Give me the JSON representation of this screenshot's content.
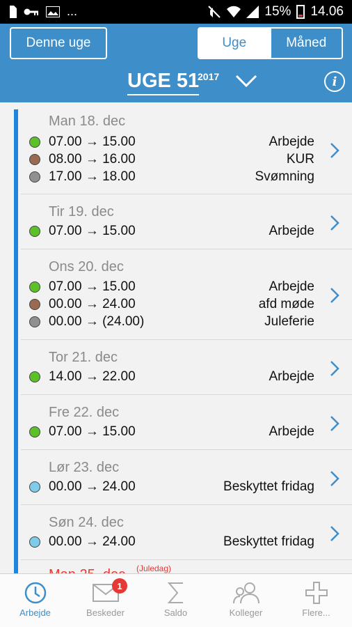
{
  "statusbar": {
    "left_icons": [
      "sim-icon",
      "key-icon",
      "image-icon"
    ],
    "ellipsis": "...",
    "battery": "15%",
    "time": "14.06"
  },
  "header": {
    "this_week_label": "Denne uge",
    "segment": [
      {
        "label": "Uge",
        "active": true
      },
      {
        "label": "Måned",
        "active": false
      }
    ],
    "week_title": "UGE 51",
    "year": "2017",
    "info_label": "i"
  },
  "days": [
    {
      "title": "Man 18. dec",
      "events": [
        {
          "time": "07.00 → 15.00",
          "name": "Arbejde",
          "color": "#5cc128"
        },
        {
          "time": "08.00 → 16.00",
          "name": "KUR",
          "color": "#9b6a52"
        },
        {
          "time": "17.00 → 18.00",
          "name": "Svømning",
          "color": "#909090"
        }
      ]
    },
    {
      "title": "Tir 19. dec",
      "events": [
        {
          "time": "07.00 → 15.00",
          "name": "Arbejde",
          "color": "#5cc128"
        }
      ]
    },
    {
      "title": "Ons 20. dec",
      "events": [
        {
          "time": "07.00 → 15.00",
          "name": "Arbejde",
          "color": "#5cc128"
        },
        {
          "time": "00.00 → 24.00",
          "name": "afd møde",
          "color": "#9b6a52"
        },
        {
          "time": "00.00 → (24.00)",
          "name": "Juleferie",
          "color": "#909090"
        }
      ]
    },
    {
      "title": "Tor 21. dec",
      "events": [
        {
          "time": "14.00 → 22.00",
          "name": "Arbejde",
          "color": "#5cc128"
        }
      ]
    },
    {
      "title": "Fre 22. dec",
      "events": [
        {
          "time": "07.00 → 15.00",
          "name": "Arbejde",
          "color": "#5cc128"
        }
      ]
    },
    {
      "title": "Lør 23. dec",
      "events": [
        {
          "time": "00.00 → 24.00",
          "name": "Beskyttet fridag",
          "color": "#7fcbea"
        }
      ]
    },
    {
      "title": "Søn 24. dec",
      "events": [
        {
          "time": "00.00 → 24.00",
          "name": "Beskyttet fridag",
          "color": "#7fcbea"
        }
      ]
    }
  ],
  "partial_day": {
    "title": "Man 25. dec",
    "tag": "(Juledag)"
  },
  "bottom_nav": [
    {
      "label": "Arbejde",
      "icon": "clock-icon",
      "active": true
    },
    {
      "label": "Beskeder",
      "icon": "envelope-icon",
      "active": false,
      "badge": "1"
    },
    {
      "label": "Saldo",
      "icon": "sigma-icon",
      "active": false
    },
    {
      "label": "Kolleger",
      "icon": "people-icon",
      "active": false
    },
    {
      "label": "Flere...",
      "icon": "plus-icon",
      "active": false
    }
  ],
  "colors": {
    "accent": "#3d8ec9",
    "timeline": "#1f86e0",
    "holiday": "#e53935"
  }
}
